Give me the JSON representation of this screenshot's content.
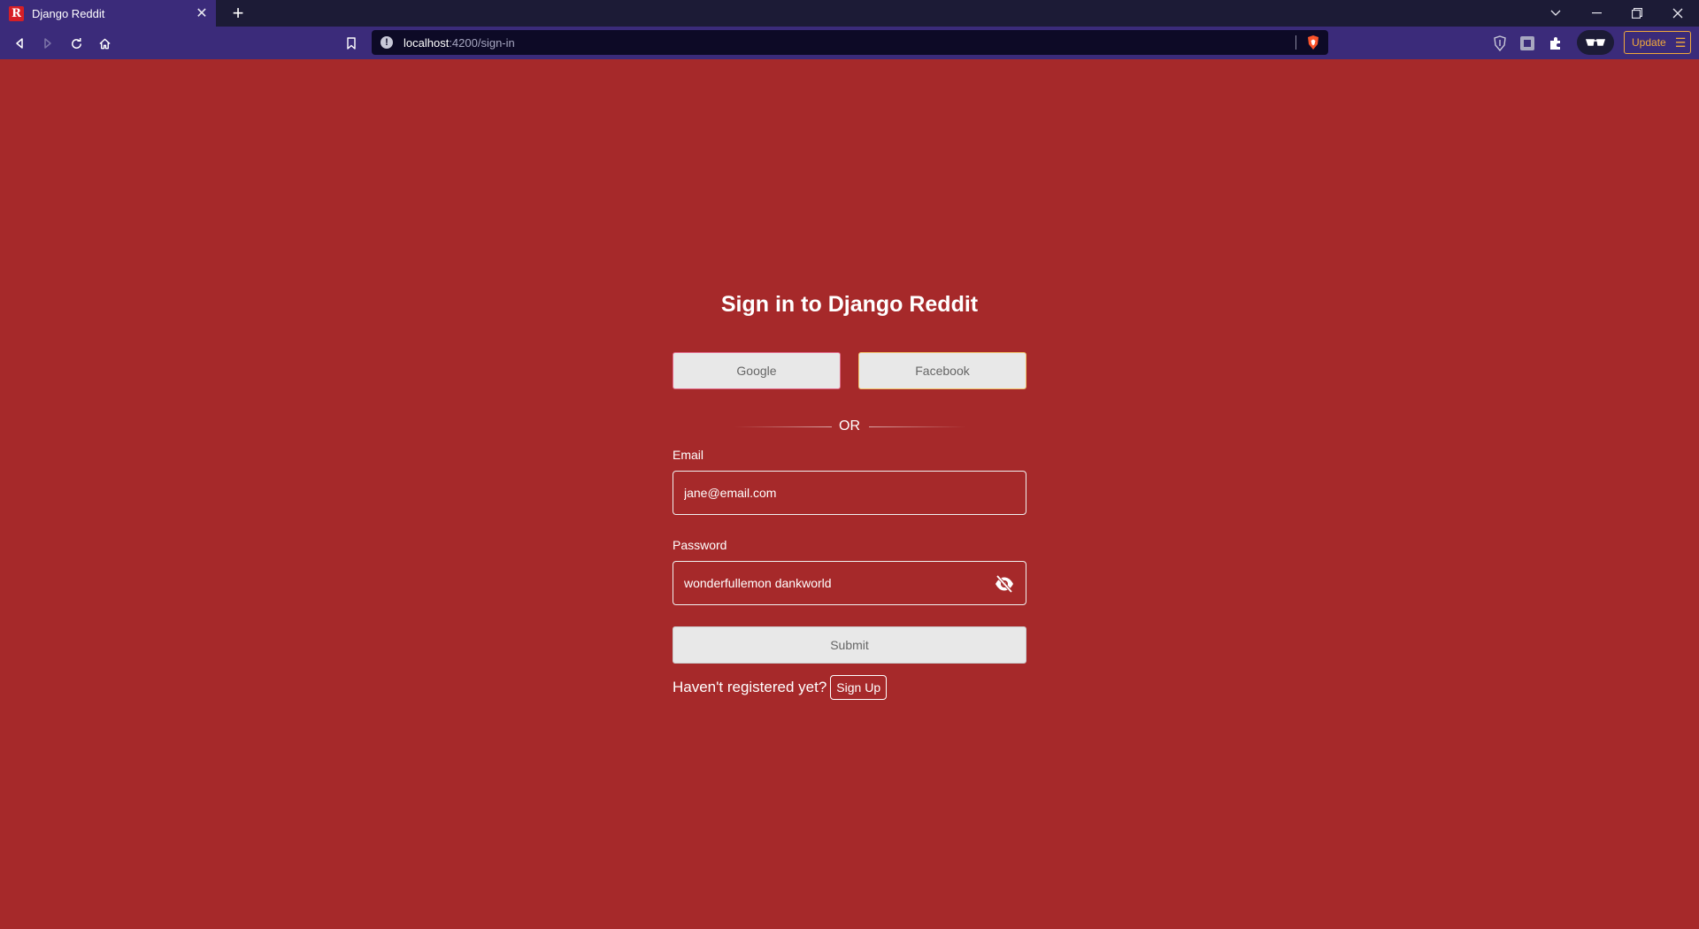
{
  "browser": {
    "tab_title": "Django Reddit",
    "tab_favicon_letter": "R",
    "url_host": "localhost",
    "url_path": ":4200/sign-in",
    "update_label": "Update"
  },
  "page": {
    "title": "Sign in to Django Reddit",
    "google_label": "Google",
    "facebook_label": "Facebook",
    "or_label": "OR",
    "email_label": "Email",
    "email_value": "jane@email.com",
    "password_label": "Password",
    "password_value": "wonderfullemon dankworld",
    "submit_label": "Submit",
    "signup_prompt": "Haven't registered yet?",
    "signup_label": "Sign Up"
  },
  "colors": {
    "background": "#a6292a",
    "chrome_dark": "#1c1b36",
    "chrome_purple": "#3b2b7a",
    "update_accent": "#f2a93b"
  },
  "icons": [
    "back-icon",
    "forward-icon",
    "reload-icon",
    "home-icon",
    "bookmark-icon",
    "info-icon",
    "brave-shield-icon",
    "brave-rewards-icon",
    "extension-icon",
    "puzzle-icon",
    "wallet-icon",
    "menu-icon",
    "eye-off-icon"
  ]
}
